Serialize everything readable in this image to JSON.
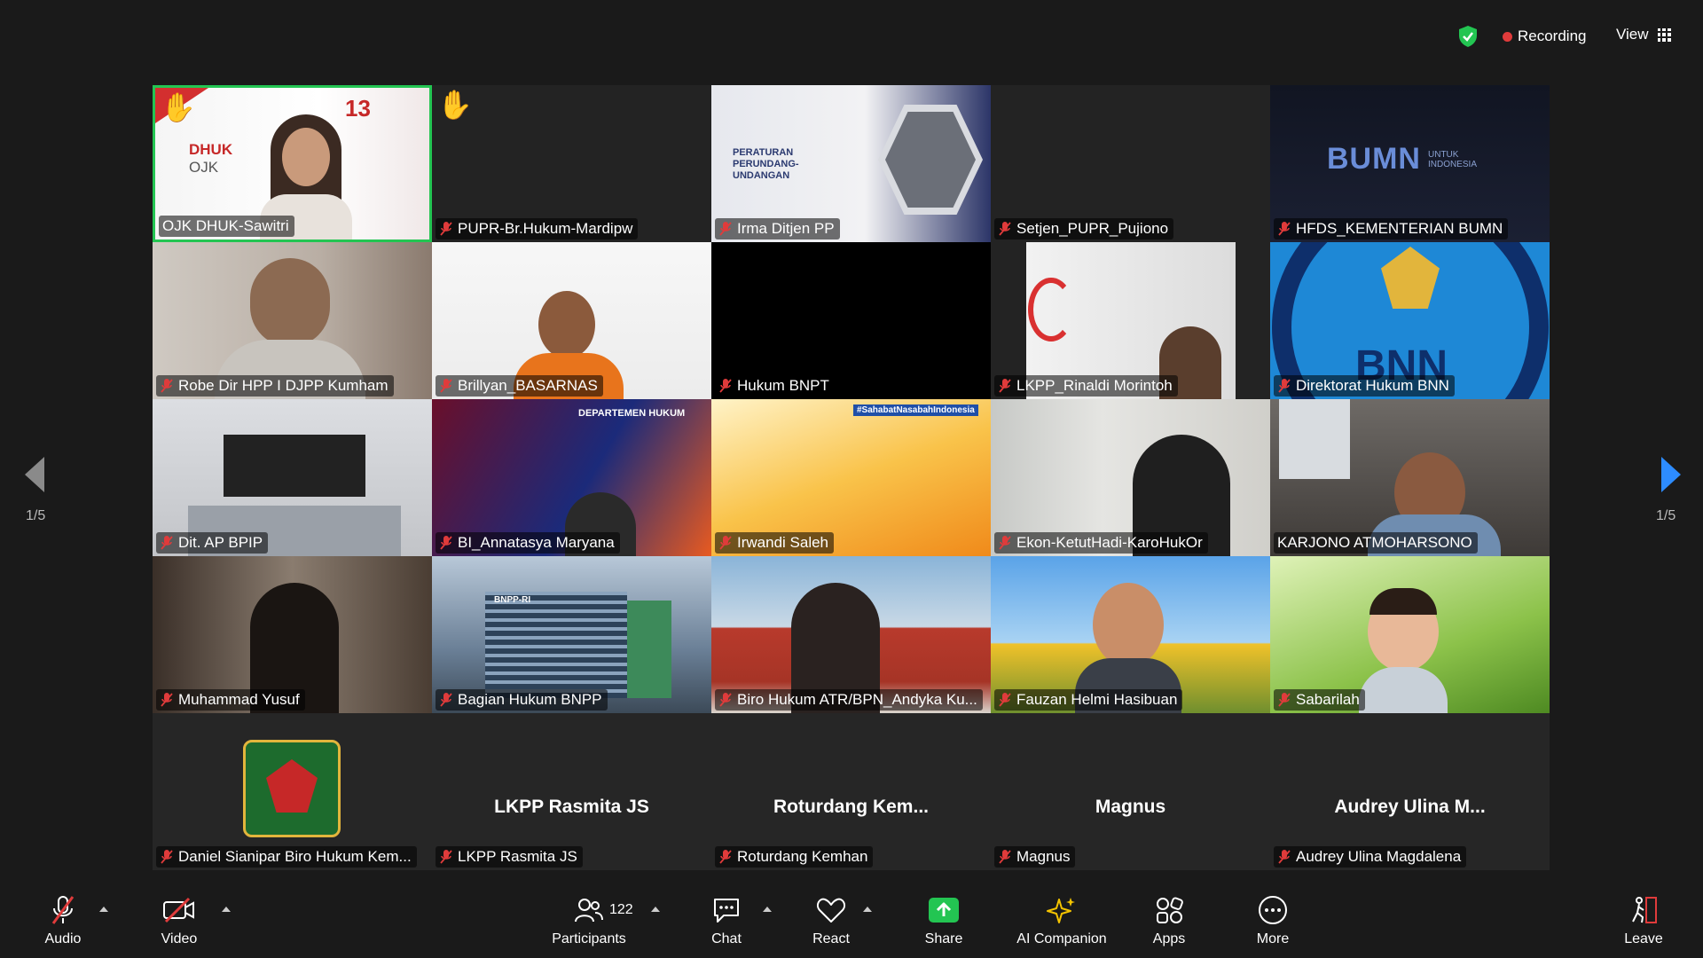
{
  "topbar": {
    "recording_label": "Recording",
    "view_label": "View"
  },
  "pagination": {
    "left": "1/5",
    "right": "1/5"
  },
  "participants": [
    {
      "name": "OJK DHUK-Sawitri"
    },
    {
      "name": "PUPR-Br.Hukum-Mardipw"
    },
    {
      "name": "Irma Ditjen PP"
    },
    {
      "name": "Setjen_PUPR_Pujiono"
    },
    {
      "name": "HFDS_KEMENTERIAN BUMN"
    },
    {
      "name": "Robe Dir HPP I DJPP Kumham"
    },
    {
      "name": "Brillyan_BASARNAS"
    },
    {
      "name": "Hukum BNPT"
    },
    {
      "name": "LKPP_Rinaldi Morintoh"
    },
    {
      "name": "Direktorat Hukum BNN"
    },
    {
      "name": "Dit. AP BPIP"
    },
    {
      "name": "BI_Annatasya Maryana"
    },
    {
      "name": "Irwandi Saleh"
    },
    {
      "name": "Ekon-KetutHadi-KaroHukOr"
    },
    {
      "name": "KARJONO ATMOHARSONO"
    },
    {
      "name": "Muhammad Yusuf"
    },
    {
      "name": "Bagian Hukum BNPP"
    },
    {
      "name": "Biro Hukum ATR/BPN_Andyka Ku..."
    },
    {
      "name": "Fauzan Helmi Hasibuan"
    },
    {
      "name": "Sabarilah"
    },
    {
      "name": "Daniel Sianipar Biro Hukum Kem...",
      "center": ""
    },
    {
      "name": "LKPP Rasmita JS",
      "center": "LKPP Rasmita JS"
    },
    {
      "name": "Roturdang Kemhan",
      "center": "Roturdang Kem..."
    },
    {
      "name": "Magnus",
      "center": "Magnus"
    },
    {
      "name": "Audrey Ulina Magdalena",
      "center": "Audrey Ulina M..."
    }
  ],
  "tile_texts": {
    "ojk_logo": "DHUK",
    "ojk_sub": "OJK",
    "bumn_logo": "BUMN",
    "bumn_sub": "UNTUK INDONESIA",
    "bnn_logo": "BNN",
    "bi_heading": "DEPARTEMEN HUKUM",
    "sahabat_tag": "#SahabatNasabahIndonesia",
    "peraturan": "PERATURAN PERUNDANG-UNDANGAN",
    "bnpp_sign": "BNPP-RI",
    "anniv": "13"
  },
  "toolbar": {
    "audio": "Audio",
    "video": "Video",
    "participants": "Participants",
    "participants_count": "122",
    "chat": "Chat",
    "react": "React",
    "share": "Share",
    "ai": "AI Companion",
    "apps": "Apps",
    "more": "More",
    "leave": "Leave"
  },
  "colors": {
    "active_speaker": "#23c552",
    "share_green": "#23c552",
    "leave_red": "#e03b3b",
    "nav_blue": "#2d8cff"
  }
}
